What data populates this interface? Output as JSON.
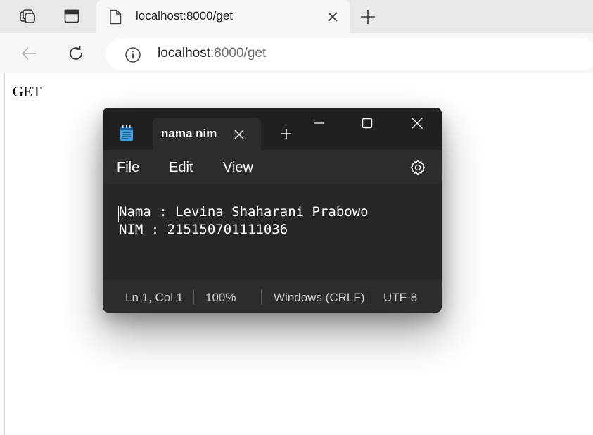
{
  "browser": {
    "tab_title": "localhost:8000/get",
    "address_host": "localhost",
    "address_rest": ":8000/get"
  },
  "page": {
    "heading": "GET"
  },
  "notepad": {
    "tab_title": "nama nim",
    "menu": [
      "File",
      "Edit",
      "View"
    ],
    "lines": [
      "Nama : Levina Shaharani Prabowo",
      "NIM : 215150701111036"
    ],
    "status": {
      "position": "Ln 1, Col 1",
      "zoom": "100%",
      "line_ending": "Windows (CRLF)",
      "encoding": "UTF-8"
    }
  }
}
